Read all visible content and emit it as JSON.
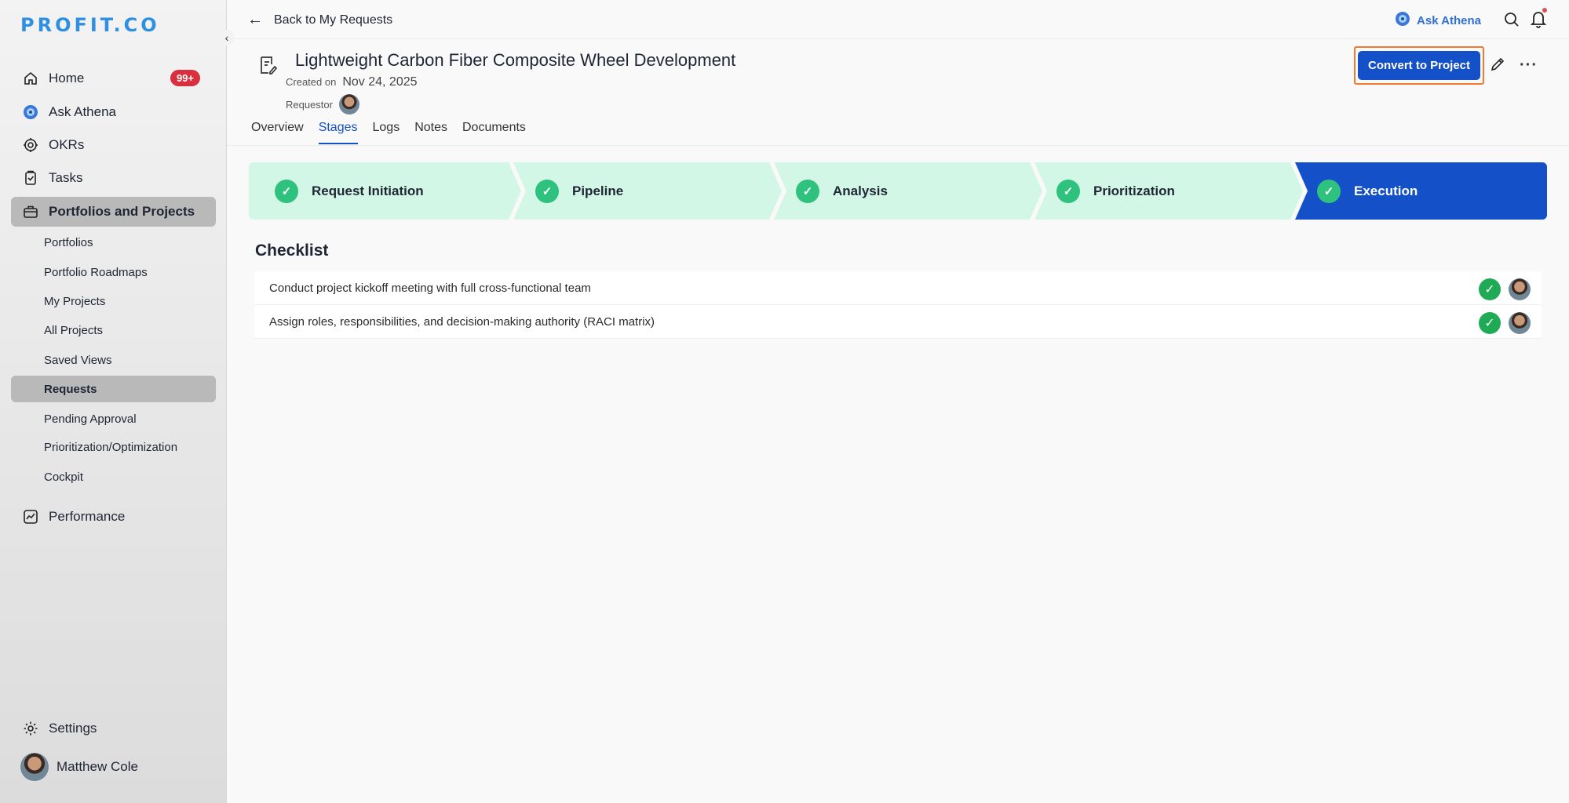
{
  "app": {
    "logo": "PROFIT.CO"
  },
  "sidebar": {
    "items": [
      {
        "label": "Home",
        "icon": "home-icon",
        "badge": "99+"
      },
      {
        "label": "Ask Athena",
        "icon": "athena-icon"
      },
      {
        "label": "OKRs",
        "icon": "target-icon"
      },
      {
        "label": "Tasks",
        "icon": "clipboard-check-icon"
      },
      {
        "label": "Portfolios and Projects",
        "icon": "briefcase-icon"
      }
    ],
    "sub_items": [
      "Portfolios",
      "Portfolio Roadmaps",
      "My Projects",
      "All Projects",
      "Saved Views",
      "Requests",
      "Pending Approval",
      "Prioritization/Optimization",
      "Cockpit"
    ],
    "performance": "Performance",
    "settings": "Settings",
    "user": "Matthew Cole"
  },
  "topbar": {
    "back": "Back to My Requests",
    "ask_athena": "Ask Athena"
  },
  "request": {
    "title": "Lightweight Carbon Fiber Composite Wheel Development",
    "created_label": "Created on",
    "created_date": "Nov 24, 2025",
    "requestor_label": "Requestor",
    "convert_button": "Convert to Project"
  },
  "tabs": [
    "Overview",
    "Stages",
    "Logs",
    "Notes",
    "Documents"
  ],
  "active_tab": "Stages",
  "stages": [
    {
      "label": "Request Initiation",
      "status": "complete"
    },
    {
      "label": "Pipeline",
      "status": "complete"
    },
    {
      "label": "Analysis",
      "status": "complete"
    },
    {
      "label": "Prioritization",
      "status": "complete"
    },
    {
      "label": "Execution",
      "status": "current"
    }
  ],
  "checklist": {
    "title": "Checklist",
    "items": [
      "Conduct project kickoff meeting with full cross-functional team",
      "Assign roles, responsibilities, and decision-making authority (RACI matrix)"
    ]
  },
  "colors": {
    "primary": "#1450c7",
    "stage_complete_bg": "#d3f7e6",
    "stage_check": "#2ec27e",
    "badge": "#d9303f",
    "highlight_border": "#f07a2f"
  }
}
